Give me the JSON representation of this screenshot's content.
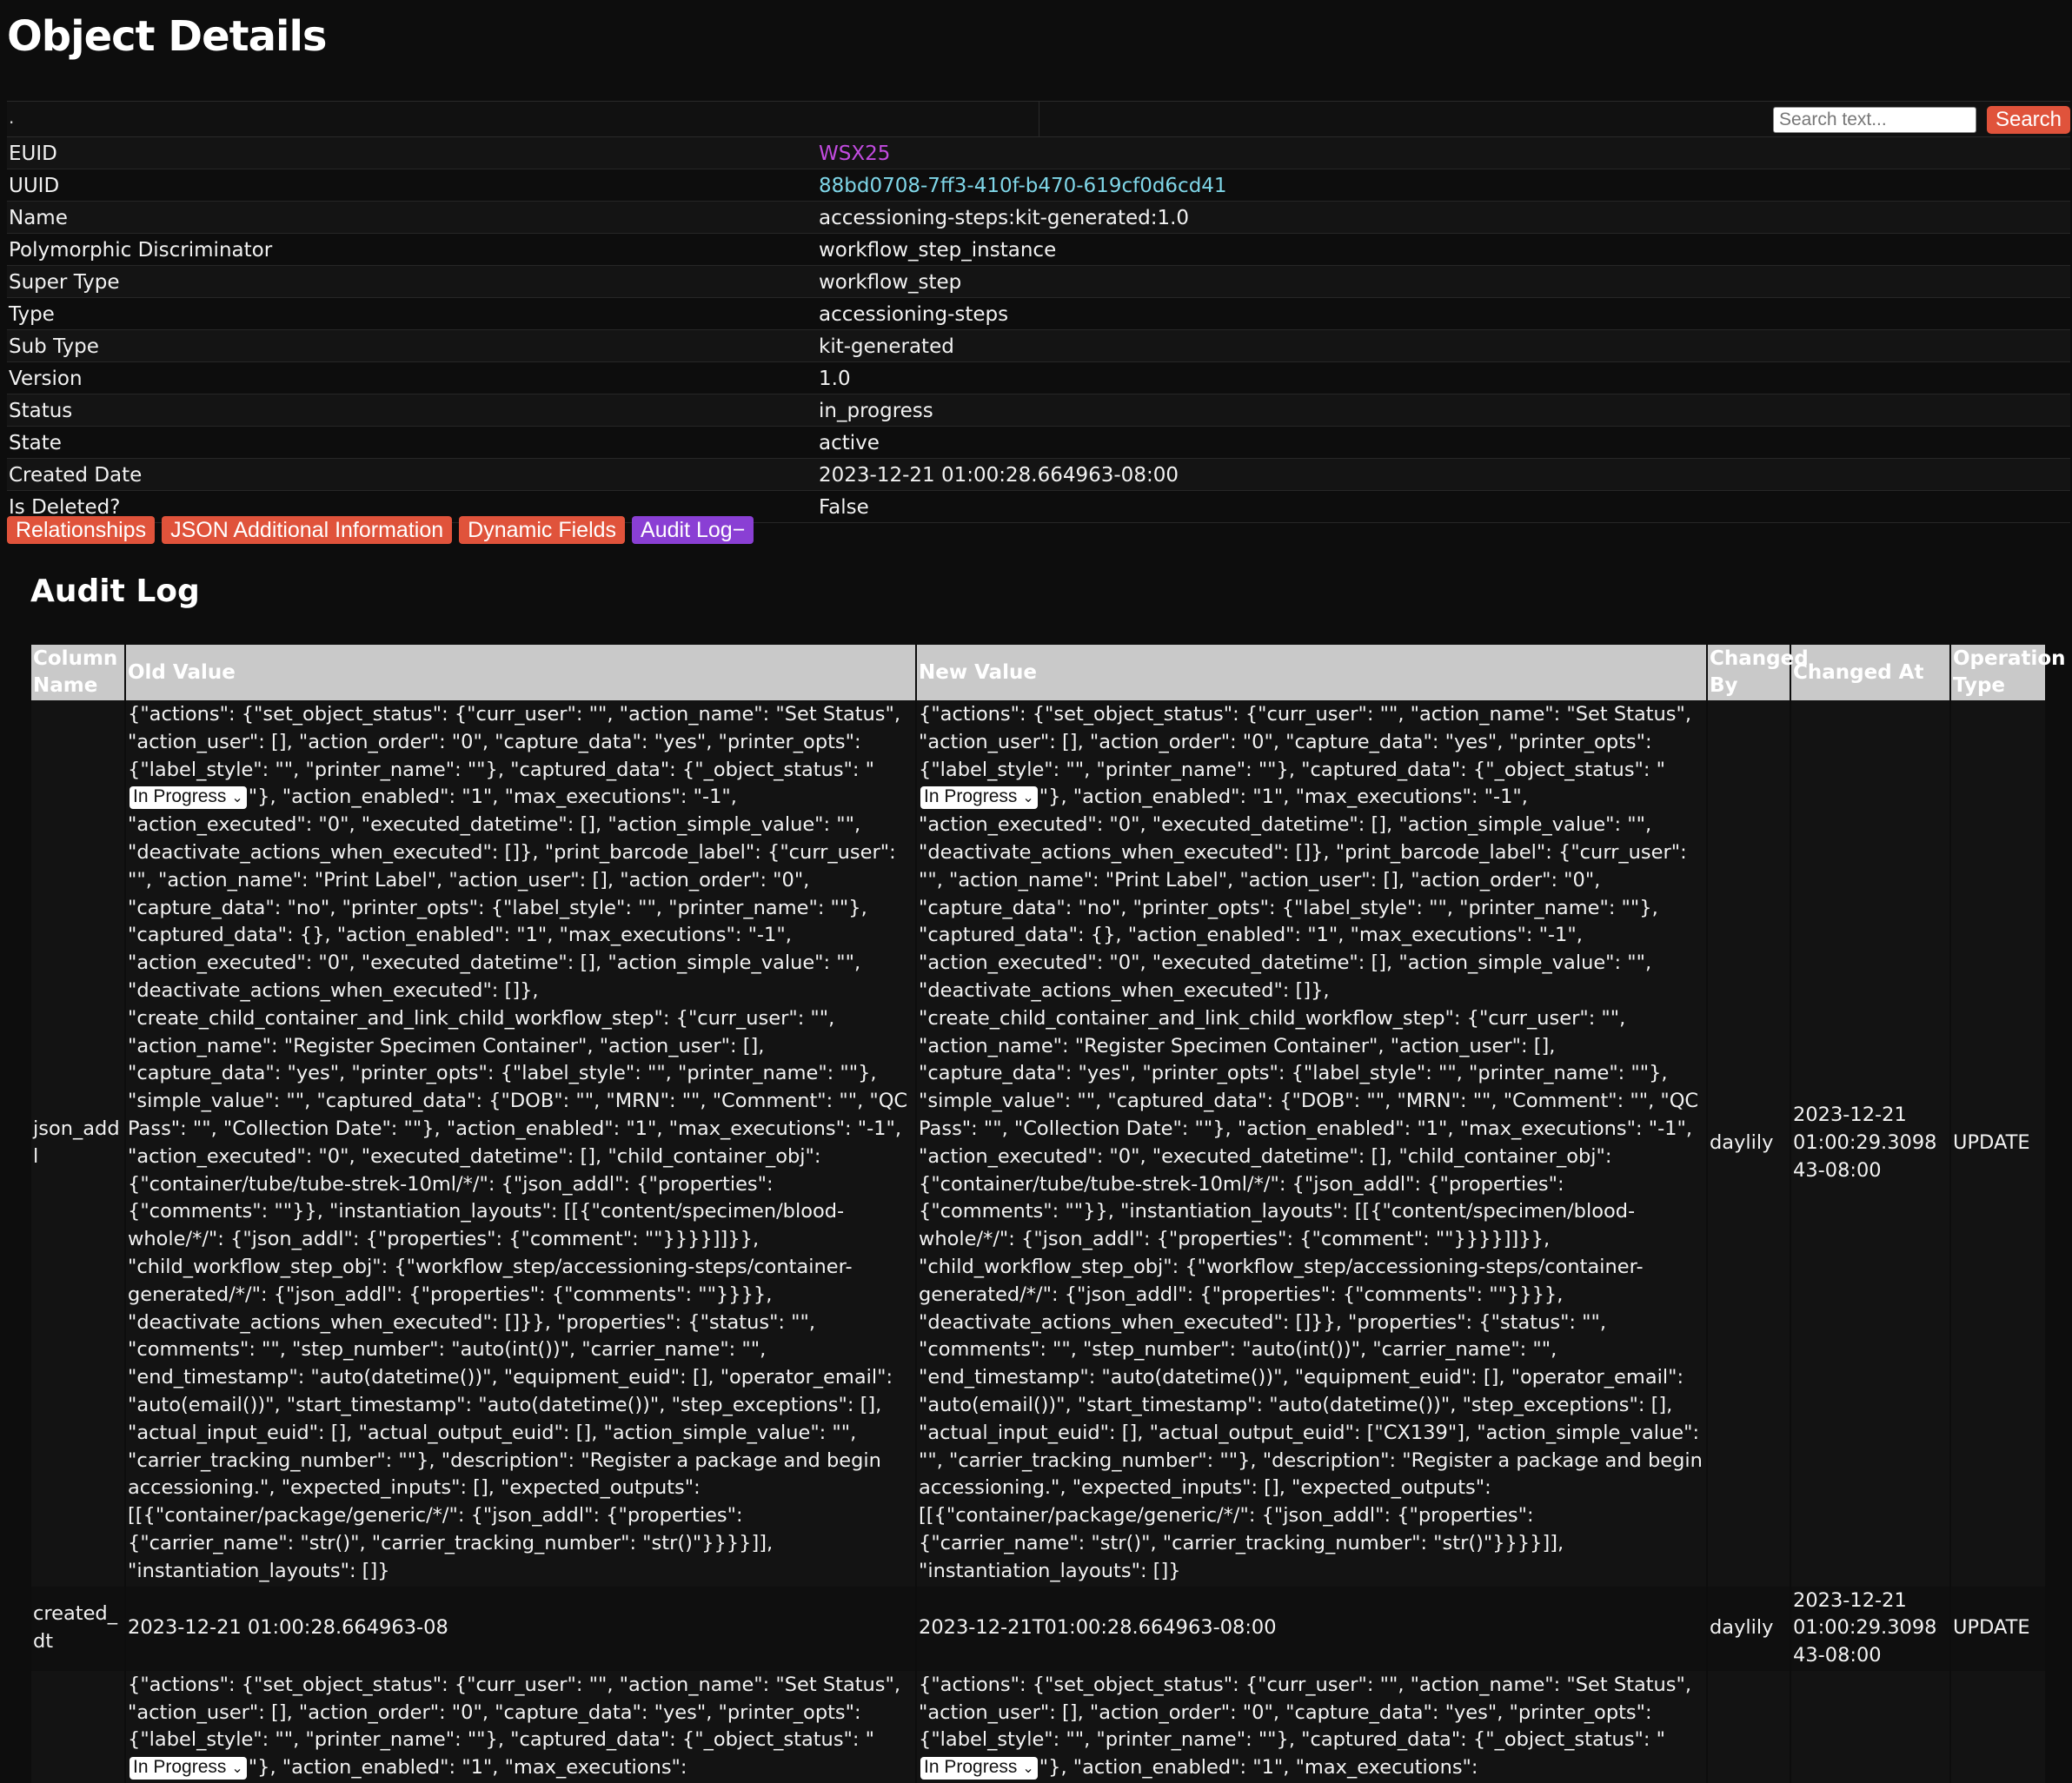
{
  "page": {
    "title": "Object Details"
  },
  "topbar": {
    "dot": ".",
    "search_placeholder": "Search text...",
    "search_button": "Search"
  },
  "properties": [
    {
      "label": "EUID",
      "value": "WSX25"
    },
    {
      "label": "UUID",
      "value": "88bd0708-7ff3-410f-b470-619cf0d6cd41"
    },
    {
      "label": "Name",
      "value": "accessioning-steps:kit-generated:1.0"
    },
    {
      "label": "Polymorphic Discriminator",
      "value": "workflow_step_instance"
    },
    {
      "label": "Super Type",
      "value": "workflow_step"
    },
    {
      "label": "Type",
      "value": "accessioning-steps"
    },
    {
      "label": "Sub Type",
      "value": "kit-generated"
    },
    {
      "label": "Version",
      "value": "1.0"
    },
    {
      "label": "Status",
      "value": "in_progress"
    },
    {
      "label": "State",
      "value": "active"
    },
    {
      "label": "Created Date",
      "value": "2023-12-21 01:00:28.664963-08:00"
    },
    {
      "label": "Is Deleted?",
      "value": "False"
    }
  ],
  "tabs": [
    {
      "label": "Relationships"
    },
    {
      "label": "JSON Additional Information"
    },
    {
      "label": "Dynamic Fields"
    },
    {
      "label": "Audit Log−"
    }
  ],
  "audit": {
    "title": "Audit Log",
    "columns": [
      "Column Name",
      "Old Value",
      "New Value",
      "Changed By",
      "Changed At",
      "Operation Type"
    ],
    "select_value": "In Progress",
    "rows": [
      {
        "column": "json_addl",
        "old_a": "{\"actions\": {\"set_object_status\": {\"curr_user\": \"\", \"action_name\": \"Set Status\", \"action_user\": [], \"action_order\": \"0\", \"capture_data\": \"yes\", \"printer_opts\": {\"label_style\": \"\", \"printer_name\": \"\"}, \"captured_data\": {\"_object_status\": \"",
        "old_b": "\"}, \"action_enabled\": \"1\", \"max_executions\": \"-1\", \"action_executed\": \"0\", \"executed_datetime\": [], \"action_simple_value\": \"\", \"deactivate_actions_when_executed\": []}, \"print_barcode_label\": {\"curr_user\": \"\", \"action_name\": \"Print Label\", \"action_user\": [], \"action_order\": \"0\", \"capture_data\": \"no\", \"printer_opts\": {\"label_style\": \"\", \"printer_name\": \"\"}, \"captured_data\": {}, \"action_enabled\": \"1\", \"max_executions\": \"-1\", \"action_executed\": \"0\", \"executed_datetime\": [], \"action_simple_value\": \"\", \"deactivate_actions_when_executed\": []}, \"create_child_container_and_link_child_workflow_step\": {\"curr_user\": \"\", \"action_name\": \"Register Specimen Container\", \"action_user\": [], \"capture_data\": \"yes\", \"printer_opts\": {\"label_style\": \"\", \"printer_name\": \"\"}, \"simple_value\": \"\", \"captured_data\": {\"DOB\": \"\", \"MRN\": \"\", \"Comment\": \"\", \"QC Pass\": \"\", \"Collection Date\": \"\"}, \"action_enabled\": \"1\", \"max_executions\": \"-1\", \"action_executed\": \"0\", \"executed_datetime\": [], \"child_container_obj\": {\"container/tube/tube-strek-10ml/*/\": {\"json_addl\": {\"properties\": {\"comments\": \"\"}}, \"instantiation_layouts\": [[{\"content/specimen/blood-whole/*/\": {\"json_addl\": {\"properties\": {\"comment\": \"\"}}}}]]}}, \"child_workflow_step_obj\": {\"workflow_step/accessioning-steps/container-generated/*/\": {\"json_addl\": {\"properties\": {\"comments\": \"\"}}}}, \"deactivate_actions_when_executed\": []}}, \"properties\": {\"status\": \"\", \"comments\": \"\", \"step_number\": \"auto(int())\", \"carrier_name\": \"\", \"end_timestamp\": \"auto(datetime())\", \"equipment_euid\": [], \"operator_email\": \"auto(email())\", \"start_timestamp\": \"auto(datetime())\", \"step_exceptions\": [], \"actual_input_euid\": [], \"actual_output_euid\": [], \"action_simple_value\": \"\", \"carrier_tracking_number\": \"\"}, \"description\": \"Register a package and begin accessioning.\", \"expected_inputs\": [], \"expected_outputs\": [[{\"container/package/generic/*/\": {\"json_addl\": {\"properties\": {\"carrier_name\": \"str()\", \"carrier_tracking_number\": \"str()\"}}}}]], \"instantiation_layouts\": []}",
        "new_a": "{\"actions\": {\"set_object_status\": {\"curr_user\": \"\", \"action_name\": \"Set Status\", \"action_user\": [], \"action_order\": \"0\", \"capture_data\": \"yes\", \"printer_opts\": {\"label_style\": \"\", \"printer_name\": \"\"}, \"captured_data\": {\"_object_status\": \"",
        "new_b": "\"}, \"action_enabled\": \"1\", \"max_executions\": \"-1\", \"action_executed\": \"0\", \"executed_datetime\": [], \"action_simple_value\": \"\", \"deactivate_actions_when_executed\": []}, \"print_barcode_label\": {\"curr_user\": \"\", \"action_name\": \"Print Label\", \"action_user\": [], \"action_order\": \"0\", \"capture_data\": \"no\", \"printer_opts\": {\"label_style\": \"\", \"printer_name\": \"\"}, \"captured_data\": {}, \"action_enabled\": \"1\", \"max_executions\": \"-1\", \"action_executed\": \"0\", \"executed_datetime\": [], \"action_simple_value\": \"\", \"deactivate_actions_when_executed\": []}, \"create_child_container_and_link_child_workflow_step\": {\"curr_user\": \"\", \"action_name\": \"Register Specimen Container\", \"action_user\": [], \"capture_data\": \"yes\", \"printer_opts\": {\"label_style\": \"\", \"printer_name\": \"\"}, \"simple_value\": \"\", \"captured_data\": {\"DOB\": \"\", \"MRN\": \"\", \"Comment\": \"\", \"QC Pass\": \"\", \"Collection Date\": \"\"}, \"action_enabled\": \"1\", \"max_executions\": \"-1\", \"action_executed\": \"0\", \"executed_datetime\": [], \"child_container_obj\": {\"container/tube/tube-strek-10ml/*/\": {\"json_addl\": {\"properties\": {\"comments\": \"\"}}, \"instantiation_layouts\": [[{\"content/specimen/blood-whole/*/\": {\"json_addl\": {\"properties\": {\"comment\": \"\"}}}}]]}}, \"child_workflow_step_obj\": {\"workflow_step/accessioning-steps/container-generated/*/\": {\"json_addl\": {\"properties\": {\"comments\": \"\"}}}}, \"deactivate_actions_when_executed\": []}}, \"properties\": {\"status\": \"\", \"comments\": \"\", \"step_number\": \"auto(int())\", \"carrier_name\": \"\", \"end_timestamp\": \"auto(datetime())\", \"equipment_euid\": [], \"operator_email\": \"auto(email())\", \"start_timestamp\": \"auto(datetime())\", \"step_exceptions\": [], \"actual_input_euid\": [], \"actual_output_euid\": [\"CX139\"], \"action_simple_value\": \"\", \"carrier_tracking_number\": \"\"}, \"description\": \"Register a package and begin accessioning.\", \"expected_inputs\": [], \"expected_outputs\": [[{\"container/package/generic/*/\": {\"json_addl\": {\"properties\": {\"carrier_name\": \"str()\", \"carrier_tracking_number\": \"str()\"}}}}]], \"instantiation_layouts\": []}",
        "changed_by": "daylily",
        "changed_at": "2023-12-21 01:00:29.309843-08:00",
        "operation": "UPDATE"
      },
      {
        "column": "created_dt",
        "old": "2023-12-21 01:00:28.664963-08",
        "new": "2023-12-21T01:00:28.664963-08:00",
        "changed_by": "daylily",
        "changed_at": "2023-12-21 01:00:29.309843-08:00",
        "operation": "UPDATE"
      },
      {
        "old_a": "{\"actions\": {\"set_object_status\": {\"curr_user\": \"\", \"action_name\": \"Set Status\", \"action_user\": [], \"action_order\": \"0\", \"capture_data\": \"yes\", \"printer_opts\": {\"label_style\": \"\", \"printer_name\": \"\"}, \"captured_data\": {\"_object_status\": \"",
        "old_b": "\"}, \"action_enabled\": \"1\", \"max_executions\":",
        "new_a": "{\"actions\": {\"set_object_status\": {\"curr_user\": \"\", \"action_name\": \"Set Status\", \"action_user\": [], \"action_order\": \"0\", \"capture_data\": \"yes\", \"printer_opts\": {\"label_style\": \"\", \"printer_name\": \"\"}, \"captured_data\": {\"_object_status\": \"",
        "new_b": "\"}, \"action_enabled\": \"1\", \"max_executions\":"
      }
    ]
  }
}
